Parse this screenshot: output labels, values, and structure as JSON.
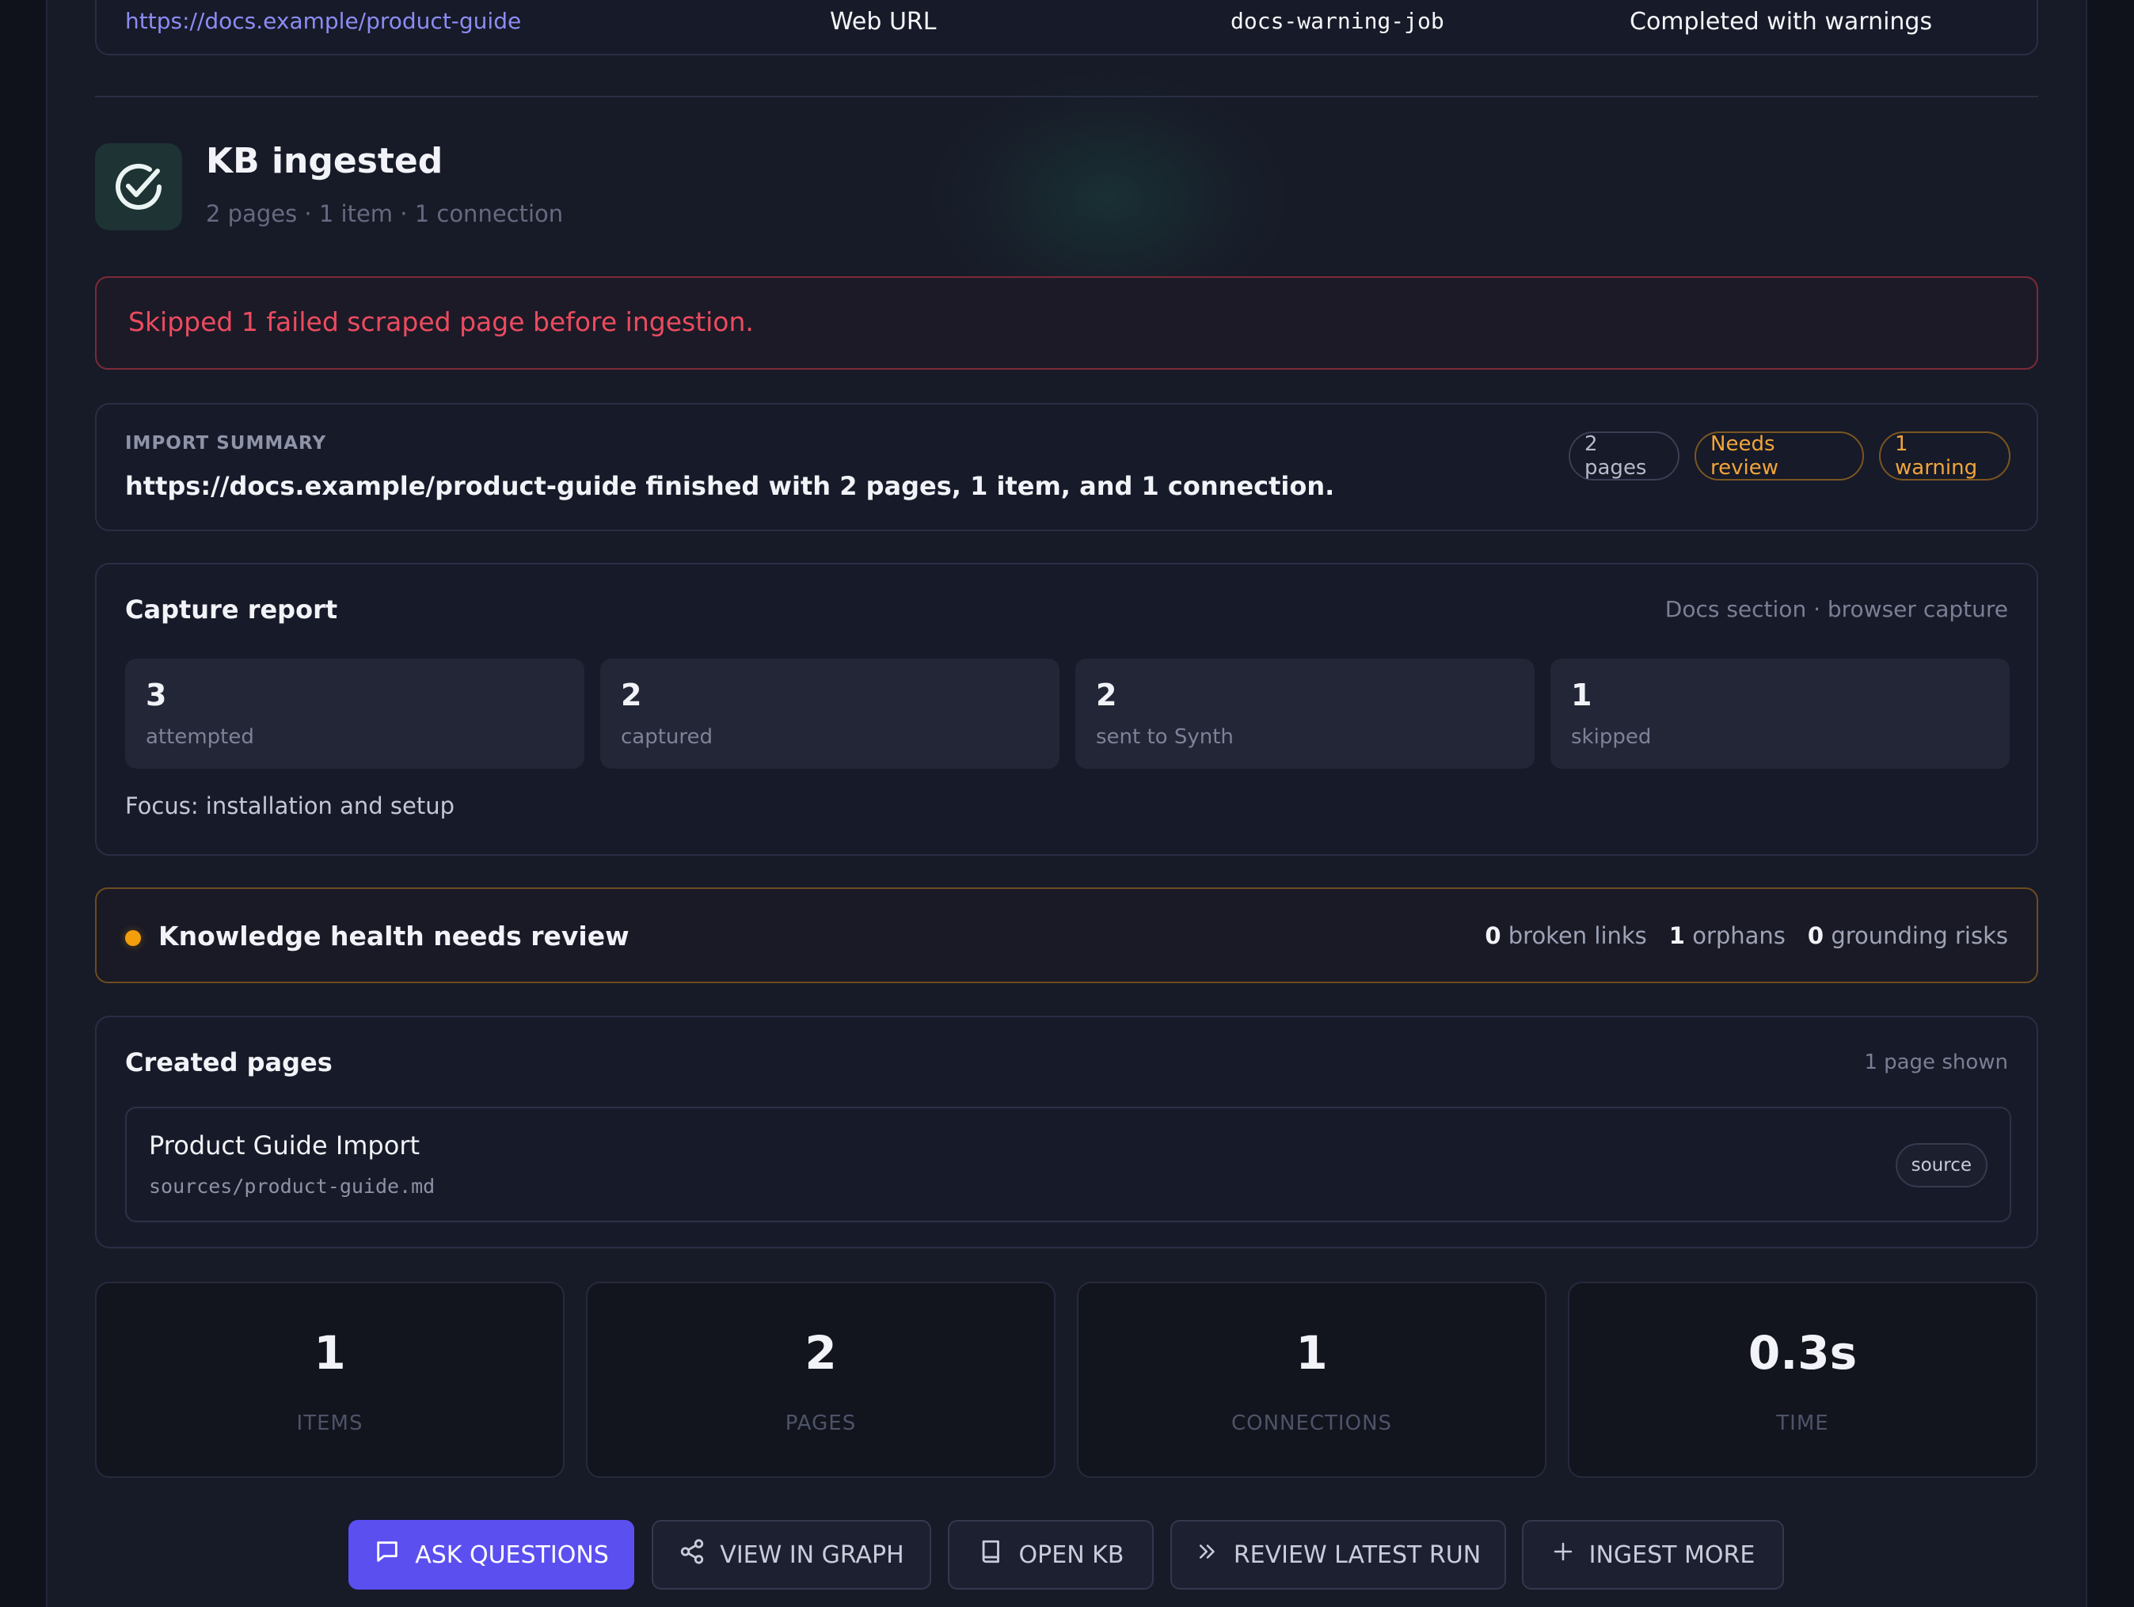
{
  "source": {
    "url": "https://docs.example/product-guide",
    "type": "Web URL",
    "job_id": "docs-warning-job",
    "status": "Completed with warnings"
  },
  "header": {
    "title": "KB ingested",
    "subtitle": "2 pages · 1 item · 1 connection",
    "icon": "check-circle-icon"
  },
  "error": {
    "message": "Skipped 1 failed scraped page before ingestion."
  },
  "import_summary": {
    "label": "IMPORT SUMMARY",
    "text": "https://docs.example/product-guide finished with 2 pages, 1 item, and 1 connection.",
    "badges": [
      "2 pages",
      "Needs review",
      "1 warning"
    ]
  },
  "capture_report": {
    "title": "Capture report",
    "meta": "Docs section · browser capture",
    "stats": [
      {
        "value": "3",
        "label": "attempted"
      },
      {
        "value": "2",
        "label": "captured"
      },
      {
        "value": "2",
        "label": "sent to Synth"
      },
      {
        "value": "1",
        "label": "skipped"
      }
    ],
    "focus": "Focus: installation and setup"
  },
  "health": {
    "title": "Knowledge health needs review",
    "broken_links": {
      "value": "0",
      "label": "broken links"
    },
    "orphans": {
      "value": "1",
      "label": "orphans"
    },
    "grounding_risks": {
      "value": "0",
      "label": "grounding risks"
    },
    "dot_color": "#f59e0b"
  },
  "created_pages": {
    "title": "Created pages",
    "meta": "1 page shown",
    "items": [
      {
        "name": "Product Guide Import",
        "path": "sources/product-guide.md",
        "tag": "source"
      }
    ]
  },
  "totals": [
    {
      "value": "1",
      "label": "ITEMS"
    },
    {
      "value": "2",
      "label": "PAGES"
    },
    {
      "value": "1",
      "label": "CONNECTIONS"
    },
    {
      "value": "0.3s",
      "label": "TIME"
    }
  ],
  "actions": {
    "ask": "ASK QUESTIONS",
    "graph": "VIEW IN GRAPH",
    "open_kb": "OPEN KB",
    "review": "REVIEW LATEST RUN",
    "ingest": "INGEST MORE"
  },
  "colors": {
    "accent": "#5b4ff0",
    "link": "#8c8cf4",
    "error": "#ec4b5f",
    "warning": "#f1a53a",
    "success": "#e8f6f2"
  }
}
